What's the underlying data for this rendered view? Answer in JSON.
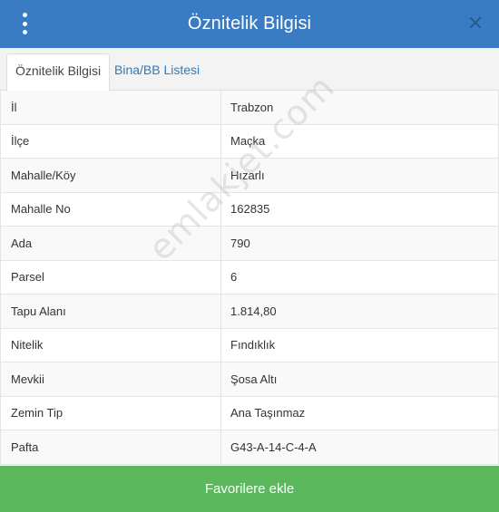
{
  "header": {
    "title": "Öznitelik Bilgisi",
    "close_glyph": "✕"
  },
  "tabs": [
    {
      "label": "Öznitelik Bilgisi",
      "active": true
    },
    {
      "label": "Bina/BB Listesi",
      "active": false
    }
  ],
  "attributes": [
    {
      "key": "İl",
      "value": "Trabzon"
    },
    {
      "key": "İlçe",
      "value": "Maçka"
    },
    {
      "key": "Mahalle/Köy",
      "value": "Hızarlı"
    },
    {
      "key": "Mahalle No",
      "value": "162835"
    },
    {
      "key": "Ada",
      "value": "790"
    },
    {
      "key": "Parsel",
      "value": "6"
    },
    {
      "key": "Tapu Alanı",
      "value": "1.814,80"
    },
    {
      "key": "Nitelik",
      "value": "Fındıklık"
    },
    {
      "key": "Mevkii",
      "value": "Şosa Altı"
    },
    {
      "key": "Zemin Tip",
      "value": "Ana Taşınmaz"
    },
    {
      "key": "Pafta",
      "value": "G43-A-14-C-4-A"
    }
  ],
  "watermark": "emlakjet.com",
  "footer": {
    "button_label": "Favorilere ekle"
  },
  "colors": {
    "header": "#3a7cc4",
    "button": "#5cb85c",
    "link": "#337ab7"
  }
}
